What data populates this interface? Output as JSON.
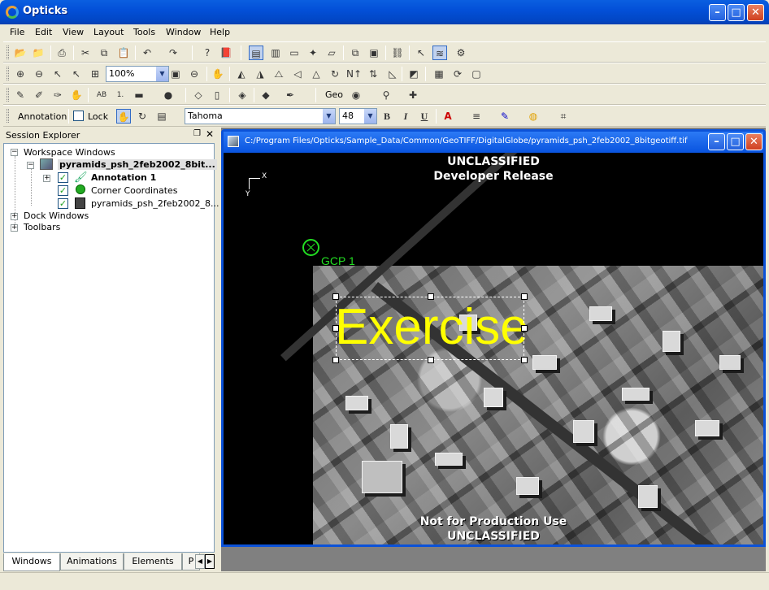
{
  "app": {
    "title": "Opticks"
  },
  "menu": [
    "File",
    "Edit",
    "View",
    "Layout",
    "Tools",
    "Window",
    "Help"
  ],
  "toolbar": {
    "zoom_value": "100%",
    "geo_label": "Geo",
    "annotation_label": "Annotation",
    "lock_label": "Lock",
    "font_name": "Tahoma",
    "font_size": "48",
    "bold": "B",
    "italic": "I",
    "underline": "U"
  },
  "session_explorer": {
    "title": "Session Explorer",
    "tree": {
      "workspace_windows": "Workspace Windows",
      "dataset": "pyramids_psh_2feb2002_8bit...",
      "annotation": "Annotation 1",
      "corner_coordinates": "Corner Coordinates",
      "raster_layer": "pyramids_psh_2feb2002_8...",
      "dock_windows": "Dock Windows",
      "toolbars": "Toolbars"
    },
    "tabs": [
      "Windows",
      "Animations",
      "Elements",
      "P"
    ]
  },
  "workspace": {
    "window_title": "C:/Program Files/Opticks/Sample_Data/Common/GeoTIFF/DigitalGlobe/pyramids_psh_2feb2002_8bitgeotiff.tif",
    "banner_top_1": "UNCLASSIFIED",
    "banner_top_2": "Developer Release",
    "banner_bottom_1": "Not for Production Use",
    "banner_bottom_2": "UNCLASSIFIED",
    "axis_x": "X",
    "axis_y": "Y",
    "gcp_label": "GCP 1",
    "annotation_text": "Exercise"
  },
  "colors": {
    "titlebar": "#0350d8",
    "annotation_text": "#ffff00",
    "gcp": "#22dd22",
    "background": "#ece9d8"
  }
}
